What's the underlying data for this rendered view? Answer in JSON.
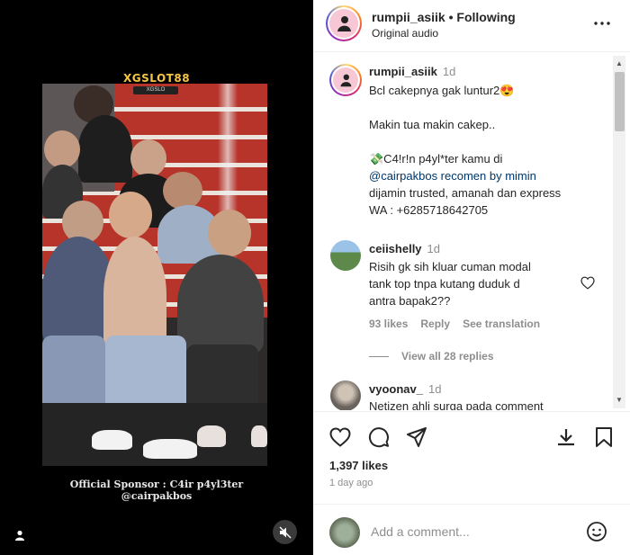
{
  "media": {
    "overlay_logo": "XGSLOT88",
    "overlay_logo_sub": "XGSLO",
    "sponsor_text": "Official Sponsor : C4ir p4yl3ter @cairpakbos"
  },
  "header": {
    "username": "rumpii_asiik",
    "separator": "•",
    "follow_status": "Following",
    "audio": "Original audio"
  },
  "comments": [
    {
      "username": "rumpii_asiik",
      "time": "1d",
      "lines": [
        "Bcl cakepnya gak luntur2😍",
        "",
        "Makin tua makin cakep..",
        "",
        "💸C4!r!n p4yl*ter kamu di",
        "@cairpakbos recomen by mimin",
        "dijamin trusted, amanah dan express",
        "WA : +6285718642705"
      ]
    },
    {
      "username": "ceiishelly",
      "time": "1d",
      "lines": [
        "Risih gk sih kluar cuman modal",
        "tank top tnpa kutang duduk d",
        "antra bapak2??"
      ],
      "likes": "93 likes",
      "reply": "Reply",
      "translate": "See translation",
      "view_replies": "View all 28 replies"
    },
    {
      "username": "vyoonav_",
      "time": "1d",
      "lines": [
        "Netizen ahli surga pada comment"
      ]
    }
  ],
  "post": {
    "likes": "1,397 likes",
    "time_ago": "1 day ago"
  },
  "add_comment": {
    "placeholder": "Add a comment..."
  }
}
